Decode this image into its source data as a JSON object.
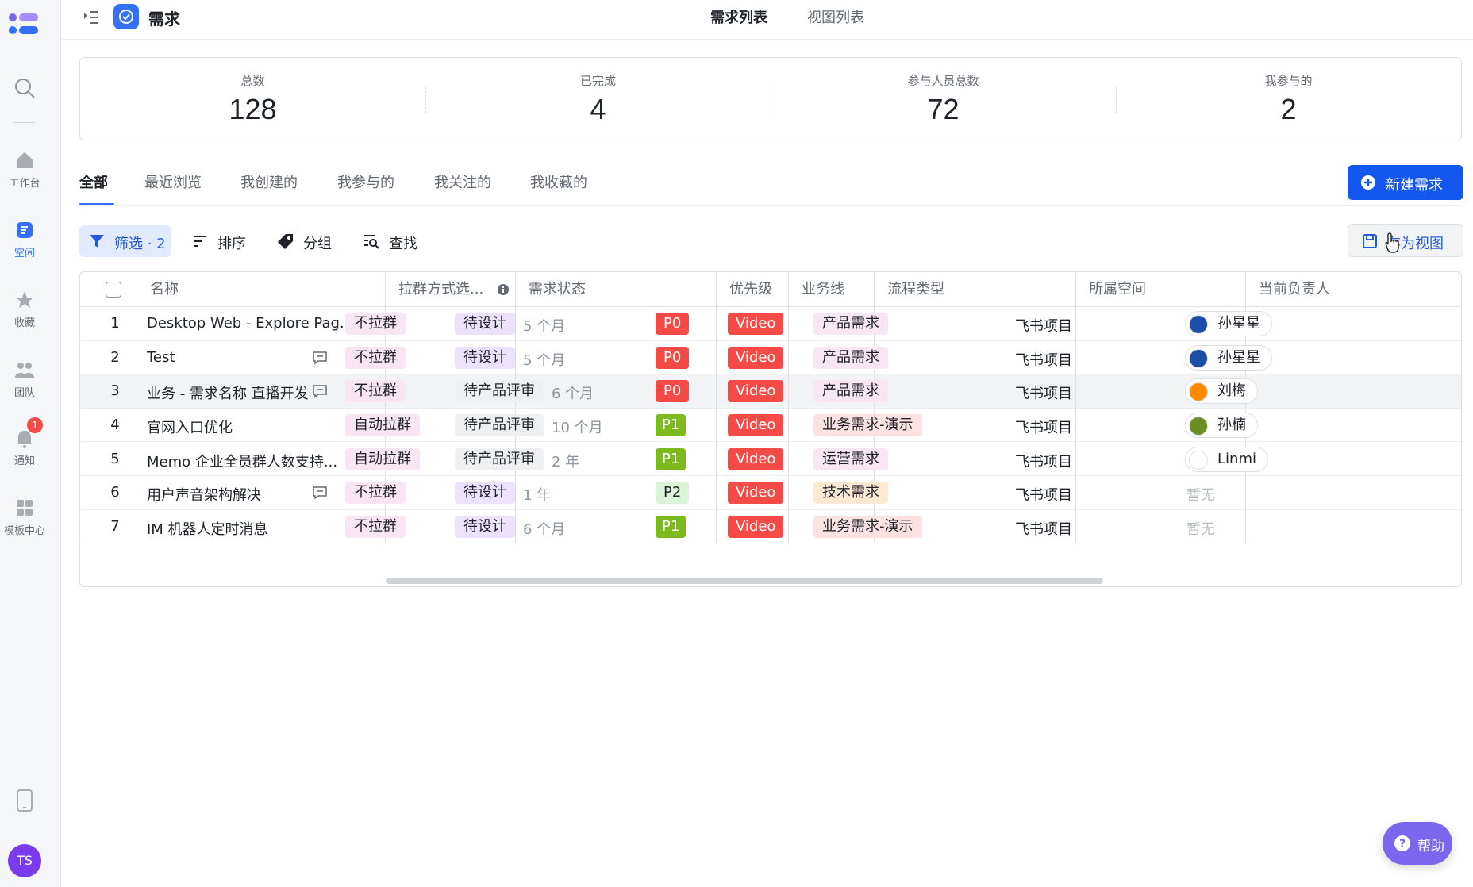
{
  "sidebar": {
    "items": [
      {
        "label": "工作台",
        "icon": "home-icon"
      },
      {
        "label": "空间",
        "icon": "space-icon"
      },
      {
        "label": "收藏",
        "icon": "star-icon"
      },
      {
        "label": "团队",
        "icon": "team-icon"
      },
      {
        "label": "通知",
        "icon": "bell-icon"
      },
      {
        "label": "模板中心",
        "icon": "template-icon"
      }
    ],
    "active": "空间",
    "notification_badge": "1",
    "avatar": "TS"
  },
  "topbar": {
    "app_title": "需求",
    "tabs": [
      "需求列表",
      "视图列表"
    ],
    "active_tab": "需求列表"
  },
  "stats": [
    {
      "label": "总数",
      "value": "128"
    },
    {
      "label": "已完成",
      "value": "4"
    },
    {
      "label": "参与人员总数",
      "value": "72"
    },
    {
      "label": "我参与的",
      "value": "2"
    }
  ],
  "filter_tabs": {
    "tabs": [
      "全部",
      "最近浏览",
      "我创建的",
      "我参与的",
      "我关注的",
      "我收藏的"
    ],
    "active": "全部",
    "new_button": "新建需求"
  },
  "toolbar": {
    "filter": "筛选 · 2",
    "sort": "排序",
    "group": "分组",
    "search": "查找",
    "save_view": "存为视图"
  },
  "table": {
    "columns": [
      "名称",
      "拉群方式选...",
      "需求状态",
      "优先级",
      "业务线",
      "流程类型",
      "所属空间",
      "当前负责人"
    ],
    "rows": [
      {
        "num": "1",
        "name": "Desktop Web - Explore Pag...",
        "comment": false,
        "group": "不拉群",
        "status": "待设计",
        "time": "5 个月",
        "priority": "P0",
        "line": "Video",
        "flow": "产品需求",
        "space": "飞书项目",
        "owner": "孙星星"
      },
      {
        "num": "2",
        "name": "Test",
        "comment": true,
        "group": "不拉群",
        "status": "待设计",
        "time": "5 个月",
        "priority": "P0",
        "line": "Video",
        "flow": "产品需求",
        "space": "飞书项目",
        "owner": "孙星星"
      },
      {
        "num": "3",
        "name": "业务 - 需求名称 直播开发",
        "comment": true,
        "group": "不拉群",
        "status": "待产品评审",
        "time": "6 个月",
        "priority": "P0",
        "line": "Video",
        "flow": "产品需求",
        "space": "飞书项目",
        "owner": "刘梅"
      },
      {
        "num": "4",
        "name": "官网入口优化",
        "comment": false,
        "group": "自动拉群",
        "status": "待产品评审",
        "time": "10 个月",
        "priority": "P1",
        "line": "Video",
        "flow": "业务需求-演示",
        "space": "飞书项目",
        "owner": "孙楠"
      },
      {
        "num": "5",
        "name": "Memo 企业全员群人数支持...",
        "comment": false,
        "group": "自动拉群",
        "status": "待产品评审",
        "time": "2 年",
        "priority": "P1",
        "line": "Video",
        "flow": "运营需求",
        "space": "飞书项目",
        "owner": "Linmi"
      },
      {
        "num": "6",
        "name": "用户声音架构解决",
        "comment": true,
        "group": "不拉群",
        "status": "待设计",
        "time": "1 年",
        "priority": "P2",
        "line": "Video",
        "flow": "技术需求",
        "space": "飞书项目",
        "owner": "暂无"
      },
      {
        "num": "7",
        "name": "IM 机器人定时消息",
        "comment": false,
        "group": "不拉群",
        "status": "待设计",
        "time": "6 个月",
        "priority": "P1",
        "line": "Video",
        "flow": "业务需求-演示",
        "space": "飞书项目",
        "owner": "暂无"
      }
    ]
  },
  "help_button": "帮助",
  "colors": {
    "accent": "#3370ff",
    "primary_button": "#1456f0",
    "p0": "#f54a45",
    "p1": "#7cba1e",
    "help": "#7b67ee"
  }
}
